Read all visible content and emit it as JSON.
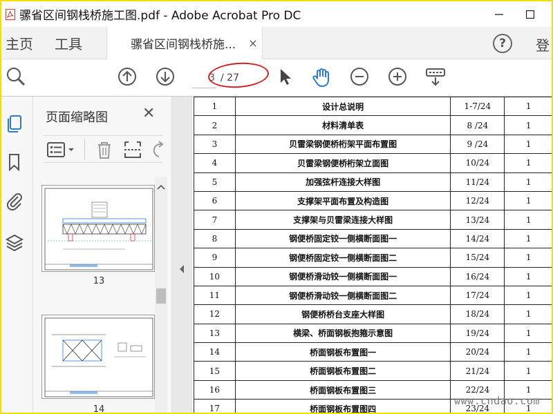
{
  "window": {
    "title": "骡省区间钢栈桥施工图.pdf - Adobe Acrobat Pro DC",
    "minimize": "—",
    "maximize": "☐"
  },
  "tabs": {
    "home": "主页",
    "tools": "工具",
    "document_tab": "骡省区间钢栈桥施...",
    "document_tab_close": "×",
    "help": "?",
    "login": "登"
  },
  "toolbar": {
    "current_page": "3",
    "page_total": "/ 27"
  },
  "panel": {
    "title": "页面缩略图",
    "close": "✕",
    "thumbnails": [
      {
        "page": "13"
      },
      {
        "page": "14"
      }
    ]
  },
  "document": {
    "rows": [
      {
        "no": "1",
        "name": "设计总说明",
        "page": "1-7/24",
        "qty": "1"
      },
      {
        "no": "2",
        "name": "材料清单表",
        "page": "8 /24",
        "qty": "1"
      },
      {
        "no": "3",
        "name": "贝雷梁钢便桥桁架平面布置图",
        "page": "9 /24",
        "qty": "1"
      },
      {
        "no": "4",
        "name": "贝雷梁钢便桥桁架立面图",
        "page": "10/24",
        "qty": "1"
      },
      {
        "no": "5",
        "name": "加强弦杆连接大样图",
        "page": "11/24",
        "qty": "1"
      },
      {
        "no": "6",
        "name": "支撑架平面布置及构造图",
        "page": "12/24",
        "qty": "1"
      },
      {
        "no": "7",
        "name": "支撑架与贝雷梁连接大样图",
        "page": "13/24",
        "qty": "1"
      },
      {
        "no": "8",
        "name": "钢便桥固定铰一侧横断面图一",
        "page": "14/24",
        "qty": "1"
      },
      {
        "no": "9",
        "name": "钢便桥固定铰一侧横断面图二",
        "page": "15/24",
        "qty": "1"
      },
      {
        "no": "10",
        "name": "钢便桥滑动铰一侧横断面图一",
        "page": "16/24",
        "qty": "1"
      },
      {
        "no": "11",
        "name": "钢便桥滑动铰一侧横断面图二",
        "page": "17/24",
        "qty": "1"
      },
      {
        "no": "12",
        "name": "钢便桥桥台支座大样图",
        "page": "18/24",
        "qty": "1"
      },
      {
        "no": "13",
        "name": "横梁、桥面钢板抱箍示意图",
        "page": "19/24",
        "qty": "1"
      },
      {
        "no": "14",
        "name": "桥面钢板布置图一",
        "page": "20/24",
        "qty": "1"
      },
      {
        "no": "15",
        "name": "桥面钢板布置图二",
        "page": "21/24",
        "qty": "1"
      },
      {
        "no": "16",
        "name": "桥面钢板布置图三",
        "page": "22/24",
        "qty": "1"
      },
      {
        "no": "17",
        "name": "桥面钢板布置图四",
        "page": "23/24",
        "qty": "1"
      }
    ]
  },
  "watermark": "www.cndao.com",
  "colors": {
    "accent_blue": "#2a7ad4",
    "annotation_red": "#d02020",
    "frame_yellow": "#f4e000"
  }
}
